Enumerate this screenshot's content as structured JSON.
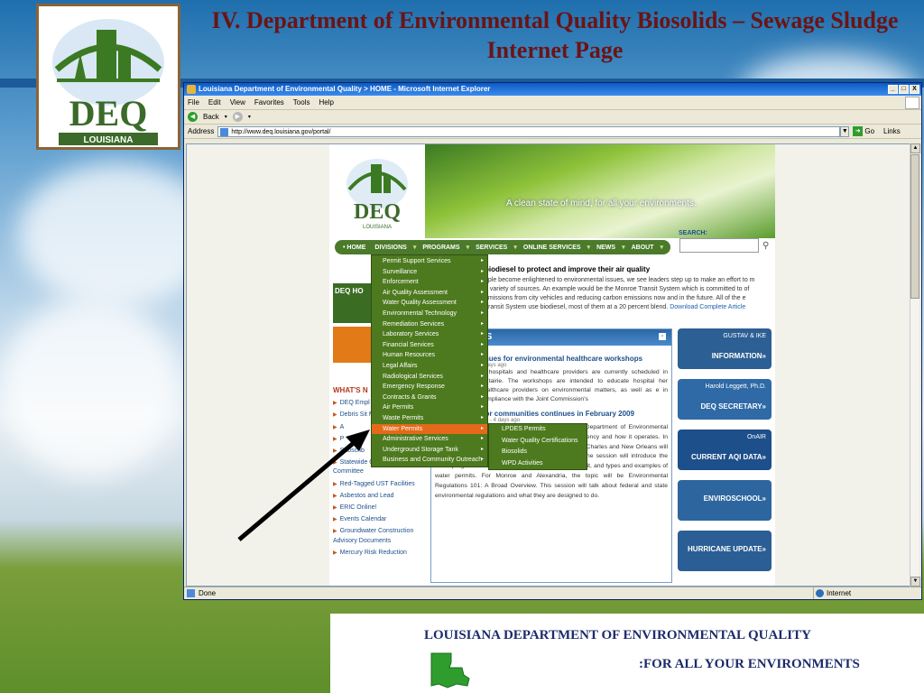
{
  "slide": {
    "title": "IV. Department of Environmental Quality Biosolids – Sewage Sludge Internet Page",
    "logo_text": "DEQ",
    "logo_sub": "LOUISIANA",
    "footer_org": "LOUISIANA DEPARTMENT OF ENVIRONMENTAL QUALITY",
    "footer_tagline": ":FOR ALL YOUR ENVIRONMENTS"
  },
  "browser": {
    "window_title": "Louisiana Department of Environmental Quality > HOME - Microsoft Internet Explorer",
    "window_buttons": [
      "_",
      "□",
      "X"
    ],
    "menu": [
      "File",
      "Edit",
      "View",
      "Favorites",
      "Tools",
      "Help"
    ],
    "back_label": "Back",
    "address_label": "Address",
    "url": "http://www.deq.louisiana.gov/portal/",
    "go_label": "Go",
    "links_label": "Links",
    "status_text": "Done",
    "zone_text": "Internet"
  },
  "site": {
    "logo_text": "DEQ",
    "logo_sub": "LOUISIANA",
    "tagline": "A clean state of mind, for all your environments.",
    "search_label": "SEARCH:",
    "nav": [
      "• HOME",
      "DIVISIONS",
      "PROGRAMS",
      "SERVICES",
      "ONLINE SERVICES",
      "NEWS",
      "ABOUT"
    ],
    "dropdown": [
      "Permit Support Services",
      "Surveillance",
      "Enforcement",
      "Air Quality Assessment",
      "Water Quality Assessment",
      "Environmental Technology",
      "Remediation Services",
      "Laboratory Services",
      "Financial Services",
      "Human Resources",
      "Legal Affairs",
      "Radiological Services",
      "Emergency Response",
      "Contracts & Grants",
      "Air Permits",
      "Waste Permits",
      "Water Permits",
      "Administrative Services",
      "Underground Storage Tank",
      "Business and Community Outreach"
    ],
    "dropdown_active": "Water Permits",
    "submenu": [
      "LPDES Permits",
      "Water Quality Certifications",
      "Biosolids",
      "WPD Activities"
    ],
    "info_banner": "DEQ HO",
    "article": {
      "headline": "biodiesel to protect and improve their air quality",
      "body": "ople become enlightened to environmental issues, we see leaders step up to make an effort to m a variety of sources. An example would be the Monroe Transit System which is committed to of emissions from city vehicles and reducing carbon emissions now and in the future. All of the e Transit System use biodiesel, most of them at a 20 percent blend.",
      "link": "Download Complete Article"
    },
    "whats_new": {
      "heading": "WHAT'S N",
      "items": [
        "DEQ Empl",
        "Debris Sit Map",
        "A",
        "P",
        "Subscrib",
        "Statewide Ozone Steering Committee",
        "Red-Tagged UST Facilities",
        "Asbestos and Lead",
        "ERIC Online!",
        "Events Calendar",
        "Groundwater Construction Advisory Documents",
        "Mercury Risk Reduction"
      ]
    },
    "news": {
      "header": "VS",
      "item1": {
        "title": "tinues for environmental healthcare workshops",
        "meta": "3 days ago",
        "body": "at hospitals and healthcare providers are currently scheduled in Metairie. The workshops are intended to educate hospital her healthcare providers on environmental matters, as well as e in compliance with the Joint Commission's"
      },
      "item2": {
        "title": "Enviroschool for communities continues in February 2009",
        "meta": "DEQ Communications - 4 days ago",
        "body": "Enviroschool is a training session presented by the Department of Environmental Quality that helps the public better understand the agency and how it operates. In February, the topic for Baton Rouge, Shreveport, Lake Charles and New Orleans will be Water Permits 101: Understanding the Process. The session will introduce the water program's mission, major regulations that govern it, and types and examples of water permits. For Monroe and Alexandria, the topic will be Environmental Regulations 101: A Broad Overview. This session will talk about federal and state environmental regulations and what they are designed to do."
      }
    },
    "right_banners": [
      {
        "label": "GUSTAV & IKE",
        "main": "INFORMATION»",
        "color": "#2c5f93"
      },
      {
        "label": "Harold Leggett, Ph.D.",
        "main": "DEQ SECRETARY»",
        "color": "#2f6aa6"
      },
      {
        "label": "OnAIR",
        "main": "CURRENT AQI DATA»",
        "color": "#1d4f8a"
      },
      {
        "label": "",
        "main": "ENVIROSCHOOL»",
        "color": "#2d669f"
      },
      {
        "label": "",
        "main": "HURRICANE UPDATE»",
        "color": "#2b5e94"
      }
    ]
  },
  "colors": {
    "title_red": "#6b1414",
    "footer_navy": "#1c2b6b",
    "nav_green": "#4b7a2a",
    "active_orange": "#e46a1a"
  }
}
